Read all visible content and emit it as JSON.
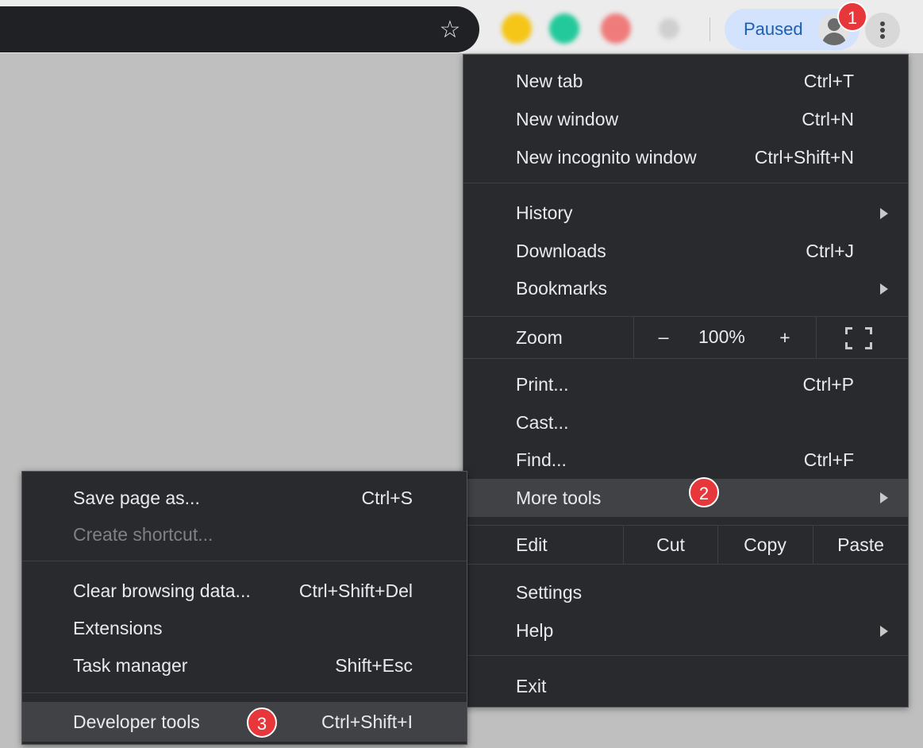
{
  "toolbar": {
    "paused_label": "Paused",
    "extension_colors": [
      "#f5c518",
      "#23c99a",
      "#f07b7b",
      "#cfcfcf"
    ]
  },
  "steps": [
    "1",
    "2",
    "3"
  ],
  "menu": {
    "new_tab": {
      "label": "New tab",
      "shortcut": "Ctrl+T"
    },
    "new_window": {
      "label": "New window",
      "shortcut": "Ctrl+N"
    },
    "new_incognito": {
      "label": "New incognito window",
      "shortcut": "Ctrl+Shift+N"
    },
    "history": {
      "label": "History"
    },
    "downloads": {
      "label": "Downloads",
      "shortcut": "Ctrl+J"
    },
    "bookmarks": {
      "label": "Bookmarks"
    },
    "zoom": {
      "label": "Zoom",
      "minus": "–",
      "level": "100%",
      "plus": "+"
    },
    "print": {
      "label": "Print...",
      "shortcut": "Ctrl+P"
    },
    "cast": {
      "label": "Cast..."
    },
    "find": {
      "label": "Find...",
      "shortcut": "Ctrl+F"
    },
    "more_tools": {
      "label": "More tools"
    },
    "edit": {
      "label": "Edit",
      "cut": "Cut",
      "copy": "Copy",
      "paste": "Paste"
    },
    "settings": {
      "label": "Settings"
    },
    "help": {
      "label": "Help"
    },
    "exit": {
      "label": "Exit"
    }
  },
  "submenu": {
    "save_page": {
      "label": "Save page as...",
      "shortcut": "Ctrl+S"
    },
    "create_shortcut": {
      "label": "Create shortcut..."
    },
    "clear_data": {
      "label": "Clear browsing data...",
      "shortcut": "Ctrl+Shift+Del"
    },
    "extensions": {
      "label": "Extensions"
    },
    "task_manager": {
      "label": "Task manager",
      "shortcut": "Shift+Esc"
    },
    "dev_tools": {
      "label": "Developer tools",
      "shortcut": "Ctrl+Shift+I"
    }
  },
  "colors": {
    "menu_bg": "#292a2d",
    "highlight": "#414246",
    "badge": "#e8373a",
    "paused_bg": "#d3e3fd"
  }
}
